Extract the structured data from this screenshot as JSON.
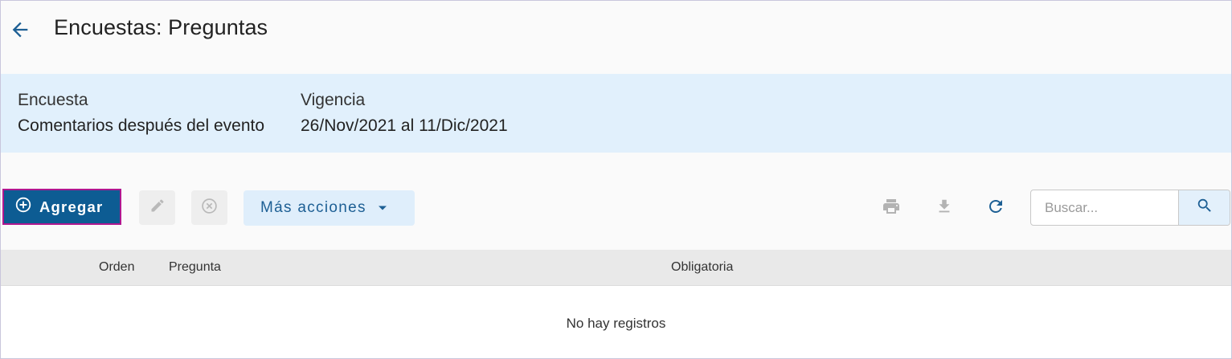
{
  "header": {
    "title": "Encuestas: Preguntas",
    "back_icon": "arrow-left-icon"
  },
  "info": {
    "survey_label": "Encuesta",
    "survey_value": "Comentarios después del evento",
    "validity_label": "Vigencia",
    "validity_value": "26/Nov/2021 al 11/Dic/2021"
  },
  "toolbar": {
    "add_label": "Agregar",
    "add_icon": "plus-circle-icon",
    "edit_icon": "pencil-icon",
    "delete_icon": "close-circle-icon",
    "more_label": "Más acciones",
    "more_icon": "caret-down-icon",
    "print_icon": "print-icon",
    "download_icon": "download-icon",
    "refresh_icon": "refresh-icon",
    "search_placeholder": "Buscar...",
    "search_icon": "search-icon"
  },
  "table": {
    "columns": [
      "Orden",
      "Pregunta",
      "Obligatoria"
    ],
    "empty_text": "No hay registros"
  },
  "colors": {
    "primary": "#0d5c93",
    "highlight_border": "#b0178f",
    "info_bg": "#e1f0fc"
  }
}
